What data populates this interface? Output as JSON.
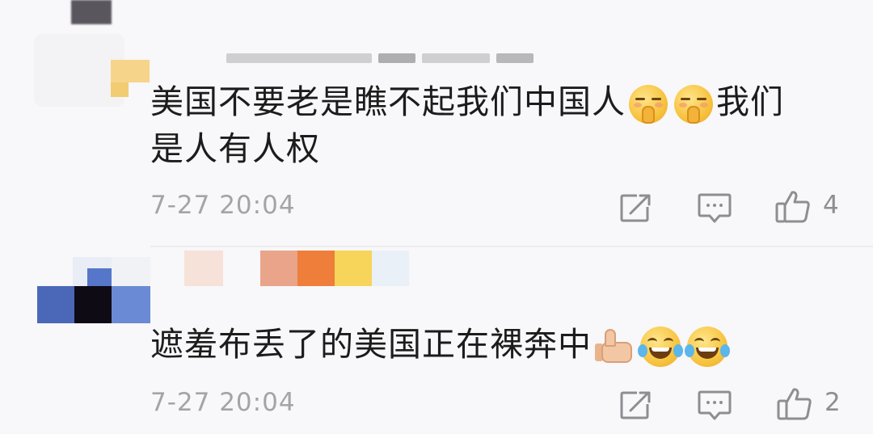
{
  "comments": [
    {
      "text_line1": "美国不要老是瞧不起我们中国人",
      "text_after_emoji": "我们",
      "text_line2": "是人有人权",
      "emojis": [
        "shushing-face",
        "shushing-face"
      ],
      "timestamp": "7-27 20:04",
      "like_count": "4"
    },
    {
      "text": "遮羞布丢了的美国正在裸奔中",
      "emojis": [
        "thumbs-up",
        "face-with-tears-of-joy",
        "face-with-tears-of-joy"
      ],
      "timestamp": "7-27 20:04",
      "like_count": "2"
    }
  ],
  "icons": {
    "repost": "repost-icon",
    "comment": "comment-icon",
    "like": "like-icon"
  },
  "colors": {
    "background": "#f8f7f9",
    "text": "#1c1c1c",
    "muted": "#a4a4a8",
    "icon": "#8e8e92"
  }
}
